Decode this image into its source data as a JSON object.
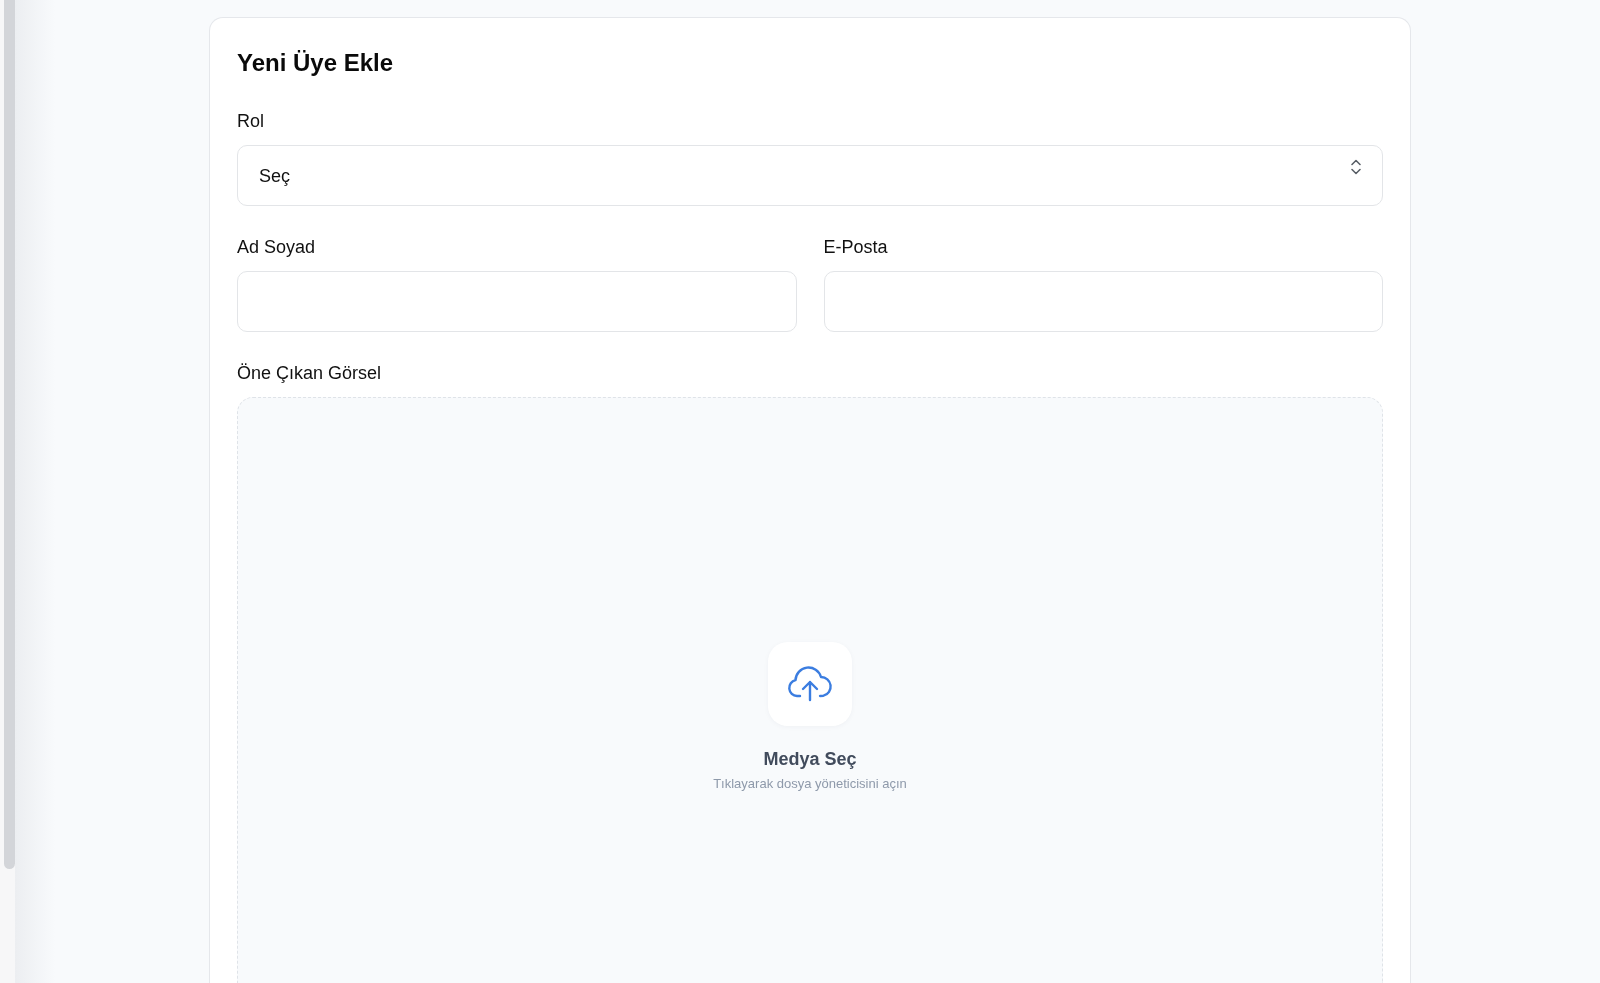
{
  "title": "Yeni Üye Ekle",
  "fields": [
    {
      "kind": "select",
      "label": "Rol",
      "value": "Seç"
    },
    {
      "kind": "text",
      "label": "Ad Soyad"
    },
    {
      "kind": "text",
      "label": "E-Posta"
    },
    {
      "kind": "media",
      "label": "Öne Çıkan Görsel",
      "button": "Medya Seç",
      "hint": "Tıklayarak dosya yöneticisini açın"
    }
  ]
}
